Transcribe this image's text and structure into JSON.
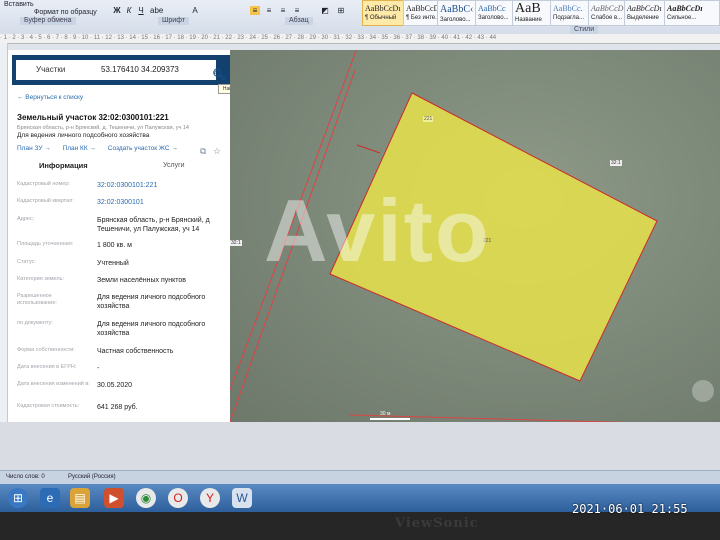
{
  "ribbon": {
    "paste": "Вставить",
    "format_painter": "Формат по образцу",
    "clipboard_group": "Буфер обмена",
    "font_group": "Шрифт",
    "paragraph_group": "Абзац",
    "styles_group": "Стили",
    "styles": [
      {
        "sample": "AaBbCcDı",
        "name": "¶ Обычный"
      },
      {
        "sample": "AaBbCcDı",
        "name": "¶ Без инте..."
      },
      {
        "sample": "AaBbC‹",
        "name": "Заголово..."
      },
      {
        "sample": "AaBbCc",
        "name": "Заголово..."
      },
      {
        "sample": "AaB",
        "name": "Название"
      },
      {
        "sample": "AaBbCc.",
        "name": "Подзагла..."
      },
      {
        "sample": "AaBbCcDı",
        "name": "Слабое в..."
      },
      {
        "sample": "AaBbCcDı",
        "name": "Выделение"
      },
      {
        "sample": "AaBbCcDı",
        "name": "Сильное..."
      }
    ]
  },
  "search": {
    "type_label": "Участки",
    "value": "53.176410 34.209373",
    "tooltip": "Найти"
  },
  "parcel": {
    "back_link": "← Вернуться к списку",
    "title": "Земельный участок 32:02:0300101:221",
    "address_small": "Брянская область, р-н Брянский, д. Тешеничи, ул Палужская, уч 14",
    "purpose": "Для ведения личного подсобного хозяйства",
    "links": [
      "План ЗУ →",
      "План КК →",
      "Создать участок ЖС →"
    ],
    "tab_info": "Информация",
    "tab_services": "Услуги",
    "rows": [
      {
        "label": "Кадастровый номер:",
        "value": "32:02:0300101:221",
        "link": true
      },
      {
        "label": "Кадастровый квартал:",
        "value": "32:02:0300101",
        "link": true
      },
      {
        "label": "Адрес:",
        "value": "Брянская область, р-н Брянский, д Тешеничи, ул Палужская, уч 14",
        "link": false
      },
      {
        "label": "Площадь уточненная:",
        "value": "1 800 кв. м",
        "link": false
      },
      {
        "label": "Статус:",
        "value": "Учтенный",
        "link": false
      },
      {
        "label": "Категория земель:",
        "value": "Земли населённых пунктов",
        "link": false
      },
      {
        "label": "Разрешенное использование:",
        "value": "Для ведения личного подсобного хозяйства",
        "link": false
      },
      {
        "label": "по документу:",
        "value": "Для ведения личного подсобного хозяйства",
        "link": false
      },
      {
        "label": "Форма собственности:",
        "value": "Частная собственность",
        "link": false
      },
      {
        "label": "Дата внесения в ЕГРН:",
        "value": "-",
        "link": false
      },
      {
        "label": "Дата внесения изменений в:",
        "value": "30.05.2020",
        "link": false
      },
      {
        "label": "Кадастровая стоимость:",
        "value": "641 268 руб.",
        "link": false
      }
    ]
  },
  "map": {
    "parcel_label_top": "221",
    "parcel_label_center": "221",
    "side_label": "32:1",
    "scale_label": "30 м",
    "watermark": "Avito"
  },
  "statusbar": {
    "words": "Число слов: 0",
    "language": "Русский (Россия)"
  },
  "monitor": {
    "brand": "ViewSonic",
    "datestamp": "2021·06·01  21:55"
  }
}
